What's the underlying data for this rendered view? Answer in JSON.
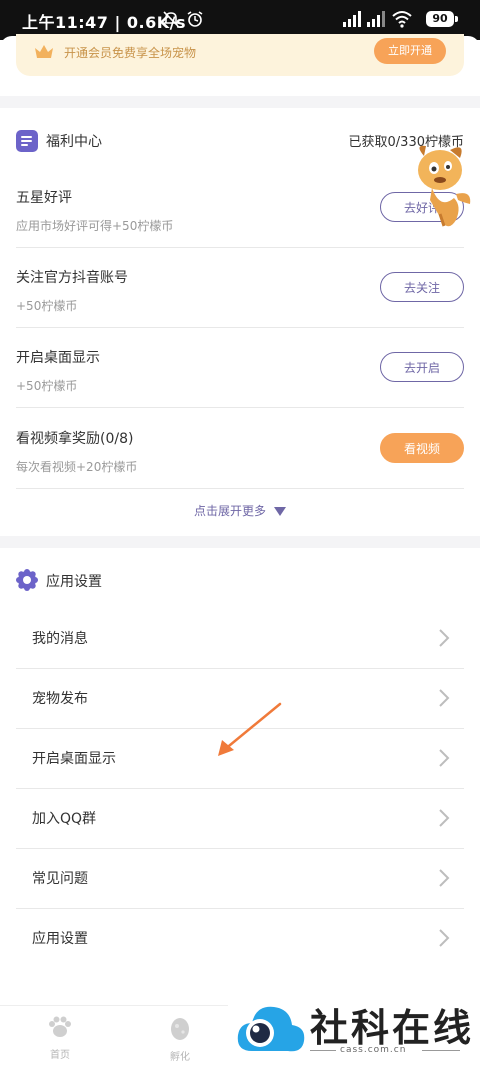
{
  "status_bar": {
    "time": "上午11:47 | 0.6K/s",
    "battery": "90"
  },
  "vip": {
    "text": "开通会员免费享全场宠物",
    "button": "立即开通"
  },
  "welfare": {
    "title": "福利中心",
    "earned": "已获取0/330柠檬币",
    "tasks": [
      {
        "title": "五星好评",
        "sub": "应用市场好评可得+50柠檬币",
        "button": "去好评"
      },
      {
        "title": "关注官方抖音账号",
        "sub": "+50柠檬币",
        "button": "去关注"
      },
      {
        "title": "开启桌面显示",
        "sub": "+50柠檬币",
        "button": "去开启"
      },
      {
        "title": "看视频拿奖励(0/8)",
        "sub": "每次看视频+20柠檬币",
        "button": "看视频"
      }
    ],
    "expand": "点击展开更多"
  },
  "settings": {
    "title": "应用设置",
    "items": [
      {
        "label": "我的消息"
      },
      {
        "label": "宠物发布"
      },
      {
        "label": "开启桌面显示"
      },
      {
        "label": "加入QQ群"
      },
      {
        "label": "常见问题"
      },
      {
        "label": "应用设置"
      }
    ]
  },
  "nav": [
    {
      "label": "首页"
    },
    {
      "label": "孵化"
    }
  ],
  "watermark": {
    "text": "社科在线",
    "url": "cass.com.cn"
  },
  "colors": {
    "accent": "#6c63c9",
    "orange": "#f7a358",
    "banner_bg": "#fdf3dc"
  }
}
